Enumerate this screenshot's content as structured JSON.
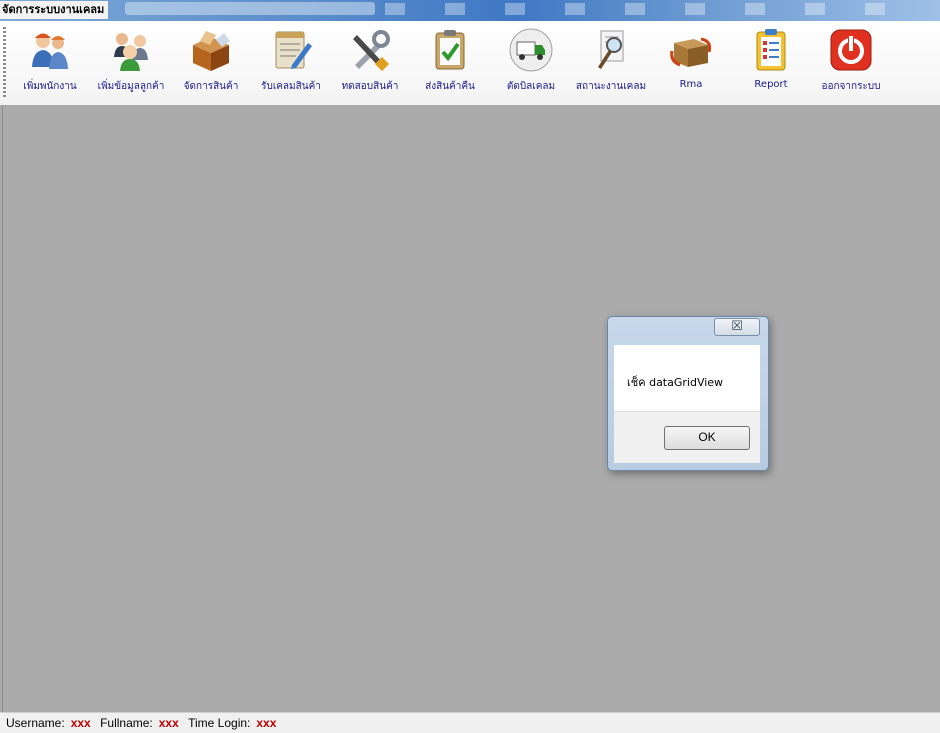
{
  "window": {
    "title": "จัดการระบบงานเคลม"
  },
  "toolbar": {
    "items": [
      {
        "label": "เพิ่มพนักงาน",
        "icon": "workers-icon"
      },
      {
        "label": "เพิ่มข้อมูลลูกค้า",
        "icon": "customers-icon"
      },
      {
        "label": "จัดการสินค้า",
        "icon": "product-box-icon"
      },
      {
        "label": "รับเคลมสินค้า",
        "icon": "notepad-pencil-icon"
      },
      {
        "label": "ทดสอบสินค้า",
        "icon": "tools-icon"
      },
      {
        "label": "ส่งสินค้าคืน",
        "icon": "clipboard-check-icon"
      },
      {
        "label": "ตัดบิลเคลม",
        "icon": "delivery-truck-icon"
      },
      {
        "label": "สถานะงานเคลม",
        "icon": "document-search-icon"
      },
      {
        "label": "Rma",
        "icon": "rma-box-icon"
      },
      {
        "label": "Report",
        "icon": "report-checklist-icon"
      },
      {
        "label": "ออกจากระบบ",
        "icon": "power-icon"
      }
    ]
  },
  "dialog": {
    "close_glyph": "☒",
    "message": "เช็ค dataGridView",
    "ok_label": "OK"
  },
  "status": {
    "username_label": "Username:",
    "username_value": "xxx",
    "fullname_label": "Fullname:",
    "fullname_value": "xxx",
    "time_label": "Time Login:",
    "time_value": "xxx"
  },
  "colors": {
    "status_value": "#c00000",
    "toolbar_label": "#1a1a8c",
    "mdi_background": "#ababab"
  }
}
